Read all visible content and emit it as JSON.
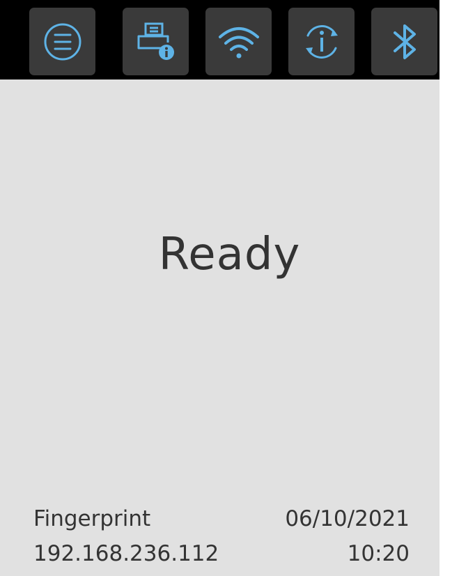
{
  "toolbar": {
    "accent_color": "#5eb3e6",
    "button_color": "#3a3a3a",
    "buttons": [
      {
        "icon": "menu-icon"
      },
      {
        "icon": "printer-info-icon"
      },
      {
        "icon": "wifi-icon"
      },
      {
        "icon": "info-refresh-icon"
      },
      {
        "icon": "bluetooth-icon"
      }
    ]
  },
  "status": {
    "text": "Ready"
  },
  "footer": {
    "app_name": "Fingerprint",
    "ip_address": "192.168.236.112",
    "date": "06/10/2021",
    "time": "10:20"
  }
}
